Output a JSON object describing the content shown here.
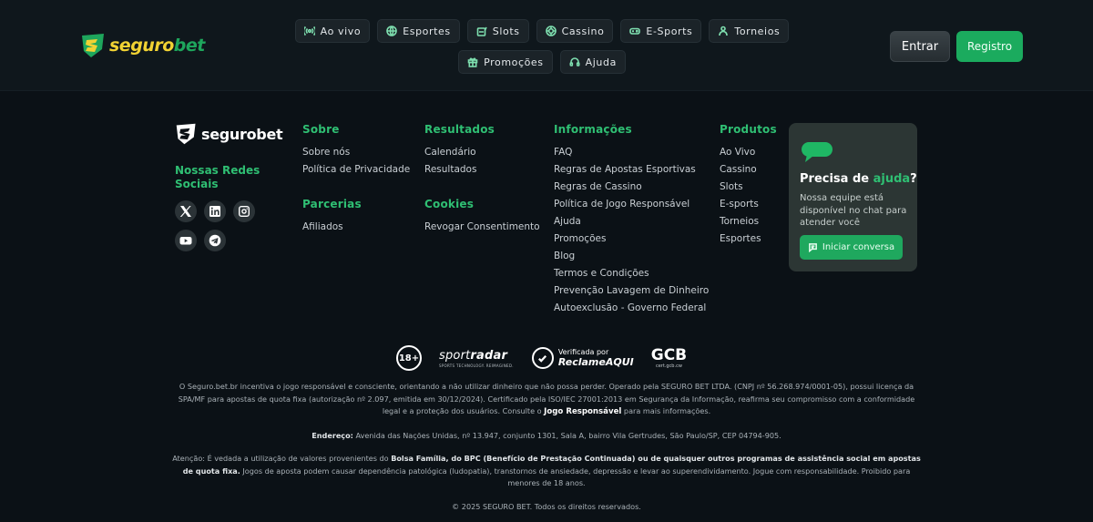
{
  "brand": {
    "name_part1": "seguro",
    "name_part2": "bet",
    "footer_name": "segurobet",
    "yellow": "#f1d233",
    "green": "#1ea65c"
  },
  "nav": [
    {
      "label": "Ao vivo",
      "icon": "live-signal-icon"
    },
    {
      "label": "Esportes",
      "icon": "globe-ball-icon"
    },
    {
      "label": "Slots",
      "icon": "slot-machine-icon"
    },
    {
      "label": "Cassino",
      "icon": "casino-chip-icon"
    },
    {
      "label": "E-Sports",
      "icon": "gamepad-icon"
    },
    {
      "label": "Torneios",
      "icon": "trophy-person-icon"
    },
    {
      "label": "Promoções",
      "icon": "gift-icon"
    },
    {
      "label": "Ajuda",
      "icon": "headset-icon"
    }
  ],
  "auth": {
    "login": "Entrar",
    "register": "Registro"
  },
  "social": {
    "title": "Nossas Redes Sociais",
    "icons": [
      "x-twitter-icon",
      "linkedin-icon",
      "instagram-icon",
      "youtube-icon",
      "telegram-icon"
    ]
  },
  "columns": {
    "sobre": {
      "title": "Sobre",
      "links": [
        "Sobre nós",
        "Política de Privacidade"
      ]
    },
    "parcerias": {
      "title": "Parcerias",
      "links": [
        "Afiliados"
      ]
    },
    "resultados": {
      "title": "Resultados",
      "links": [
        "Calendário",
        "Resultados"
      ]
    },
    "cookies": {
      "title": "Cookies",
      "links": [
        "Revogar Consentimento"
      ]
    },
    "informacoes": {
      "title": "Informações",
      "links": [
        "FAQ",
        "Regras de Apostas Esportivas",
        "Regras de Cassino",
        "Política de Jogo Responsável",
        "Ajuda",
        "Promoções",
        "Blog",
        "Termos e Condições",
        "Prevenção Lavagem de Dinheiro",
        "Autoexclusão - Governo Federal"
      ]
    },
    "produtos": {
      "title": "Produtos",
      "links": [
        "Ao Vivo",
        "Cassino",
        "Slots",
        "E-sports",
        "Torneios",
        "Esportes"
      ]
    }
  },
  "help": {
    "title_prefix": "Precisa de ",
    "title_highlight": "ajuda",
    "title_suffix": "?",
    "text": "Nossa equipe está disponível no chat para atender você",
    "button": "Iniciar conversa"
  },
  "badges": {
    "age": "18+",
    "sport_a": "sport",
    "sport_b": "radar",
    "sport_sub": "SPORTS TECHNOLOGY. REIMAGINED.",
    "reclame_top": "Verificada por",
    "reclame_bottom": "ReclameAQUI",
    "gcb": "GCB",
    "gcb_sub": "cert.gcb.cw"
  },
  "legal": {
    "p1_text": "O Seguro.bet.br incentiva o jogo responsável e consciente, orientando a não utilizar dinheiro que não possa perder. Operado pela SEGURO BET LTDA. (CNPJ nº 56.268.974/0001-05), possui licença da SPA/MF para apostas de quota fixa (autorização nº 2.097, emitida em 30/12/2024). Certificado pela ISO/IEC 27001:2013 em Segurança da Informação, reafirma seu compromisso com a conformidade legal e a proteção dos usuários. Consulte o ",
    "p1_link": "Jogo Responsável",
    "p1_end": " para mais informações.",
    "address_label": "Endereço:",
    "address": " Avenida das Nações Unidas, nº 13.947, conjunto 1301, Sala A, bairro Vila Gertrudes, São Paulo/SP, CEP 04794-905.",
    "warning_start": "Atenção: É vedada a utilização de valores provenientes do ",
    "warning_bold": "Bolsa Família, do BPC (Benefício de Prestação Continuada) ou de quaisquer outros programas de assistência social em apostas de quota fixa.",
    "warning_end": " Jogos de aposta podem causar dependência patológica (ludopatia), transtornos de ansiedade, depressão e levar ao superendividamento. Jogue com responsabilidade. Proibido para menores de 18 anos.",
    "copyright": "© 2025 SEGURO BET. Todos os direitos reservados."
  }
}
